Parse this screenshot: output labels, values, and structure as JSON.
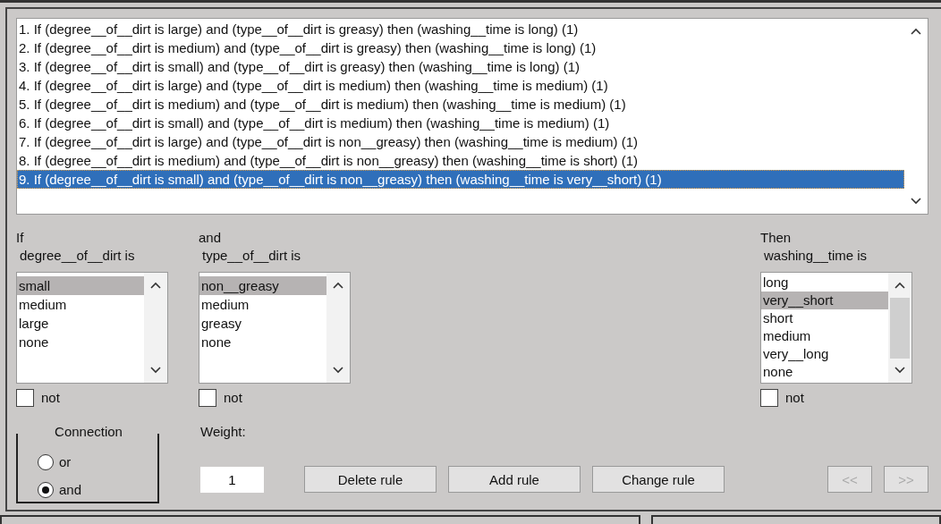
{
  "rules": [
    {
      "text": "1. If (degree__of__dirt is large) and (type__of__dirt is greasy) then (washing__time is long) (1)",
      "selected": false
    },
    {
      "text": "2. If (degree__of__dirt is medium) and (type__of__dirt is greasy) then (washing__time is long) (1)",
      "selected": false
    },
    {
      "text": "3. If (degree__of__dirt is small) and (type__of__dirt is greasy) then (washing__time is long) (1)",
      "selected": false
    },
    {
      "text": "4. If (degree__of__dirt is large) and (type__of__dirt is medium) then (washing__time is medium) (1)",
      "selected": false
    },
    {
      "text": "5. If (degree__of__dirt is medium) and (type__of__dirt is medium) then (washing__time is medium) (1)",
      "selected": false
    },
    {
      "text": "6. If (degree__of__dirt is small) and (type__of__dirt is medium) then (washing__time is medium) (1)",
      "selected": false
    },
    {
      "text": "7. If (degree__of__dirt is large) and (type__of__dirt is non__greasy) then (washing__time is medium) (1)",
      "selected": false
    },
    {
      "text": "8. If (degree__of__dirt is medium) and (type__of__dirt is non__greasy) then (washing__time is short) (1)",
      "selected": false
    },
    {
      "text": "9. If (degree__of__dirt is small) and (type__of__dirt is non__greasy) then (washing__time is very__short) (1)",
      "selected": true
    }
  ],
  "panels": [
    {
      "heading": "If",
      "variable": "degree__of__dirt is",
      "options": [
        {
          "label": "small",
          "selected": true
        },
        {
          "label": "medium",
          "selected": false
        },
        {
          "label": "large",
          "selected": false
        },
        {
          "label": "none",
          "selected": false
        }
      ],
      "not_label": "not",
      "not_checked": false
    },
    {
      "heading": "and",
      "variable": "type__of__dirt is",
      "options": [
        {
          "label": "non__greasy",
          "selected": true
        },
        {
          "label": "medium",
          "selected": false
        },
        {
          "label": "greasy",
          "selected": false
        },
        {
          "label": "none",
          "selected": false
        }
      ],
      "not_label": "not",
      "not_checked": false
    },
    {
      "heading": "Then",
      "variable": "washing__time is",
      "options": [
        {
          "label": "long",
          "selected": false
        },
        {
          "label": "very__short",
          "selected": true
        },
        {
          "label": "short",
          "selected": false
        },
        {
          "label": "medium",
          "selected": false
        },
        {
          "label": "very__long",
          "selected": false
        },
        {
          "label": "none",
          "selected": false
        }
      ],
      "not_label": "not",
      "not_checked": false
    }
  ],
  "connection": {
    "title": "Connection",
    "options": [
      {
        "label": "or",
        "selected": false
      },
      {
        "label": "and",
        "selected": true
      }
    ]
  },
  "weight": {
    "label": "Weight:",
    "value": "1"
  },
  "buttons": [
    {
      "label": "Delete rule",
      "disabled": false
    },
    {
      "label": "Add rule",
      "disabled": false
    },
    {
      "label": "Change rule",
      "disabled": false
    }
  ],
  "nav_buttons": [
    {
      "label": "<<",
      "disabled": true
    },
    {
      "label": ">>",
      "disabled": true
    }
  ]
}
